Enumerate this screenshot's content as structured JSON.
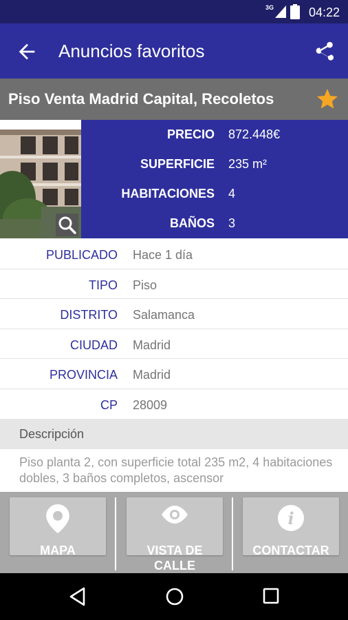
{
  "status_bar": {
    "network": "3G",
    "time": "04:22"
  },
  "app_bar": {
    "title": "Anuncios favoritos",
    "back_icon": "arrow-left-icon",
    "share_icon": "share-icon"
  },
  "listing": {
    "title": "Piso Venta Madrid Capital, Recoletos",
    "favorite_icon": "star-icon",
    "favorite_color": "#f5a623"
  },
  "summary": [
    {
      "key": "PRECIO",
      "value": "872.448€"
    },
    {
      "key": "SUPERFICIE",
      "value": "235 m²"
    },
    {
      "key": "HABITACIONES",
      "value": "4"
    },
    {
      "key": "BAÑOS",
      "value": "3"
    }
  ],
  "details": [
    {
      "key": "PUBLICADO",
      "value": "Hace 1 día"
    },
    {
      "key": "TIPO",
      "value": "Piso"
    },
    {
      "key": "DISTRITO",
      "value": "Salamanca"
    },
    {
      "key": "CIUDAD",
      "value": "Madrid"
    },
    {
      "key": "PROVINCIA",
      "value": "Madrid"
    },
    {
      "key": "CP",
      "value": "28009"
    }
  ],
  "description": {
    "header": "Descripción",
    "text": "Piso planta 2, con superficie total 235 m2, 4 habitaciones dobles, 3 baños completos, ascensor"
  },
  "actions": [
    {
      "label": "MAPA",
      "icon": "map-pin-icon"
    },
    {
      "label": "VISTA DE CALLE",
      "icon": "eye-icon"
    },
    {
      "label": "CONTACTAR",
      "icon": "info-icon"
    }
  ],
  "colors": {
    "primary": "#2e2f9c",
    "status_bar": "#1e1f66",
    "header_grey": "#6f6f6f"
  }
}
